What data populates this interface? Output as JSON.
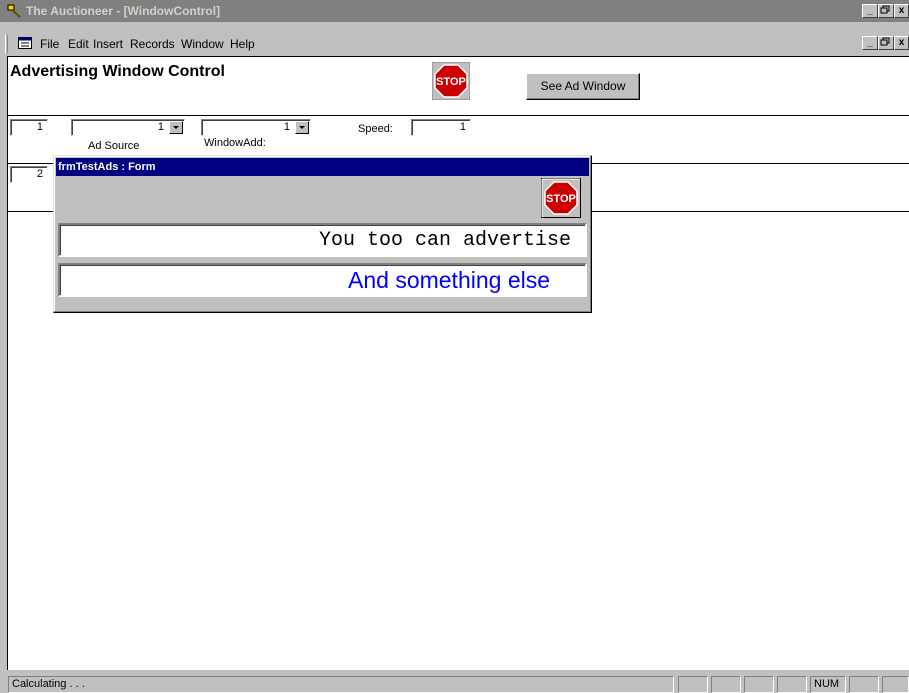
{
  "window": {
    "title": "The Auctioneer - [WindowControl]",
    "controls": [
      "_",
      " ",
      "x"
    ]
  },
  "menu": {
    "items": [
      "File",
      "Edit",
      "Insert",
      "Records",
      "Window",
      "Help"
    ]
  },
  "form": {
    "title": "Advertising Window Control",
    "stop_label": "STOP",
    "see_ad_button": "See Ad Window",
    "rows": [
      {
        "number": "1",
        "ad_source_value": "1",
        "ad_source_label": "Ad Source",
        "window_add_value": "1",
        "window_add_label": "WindowAdd:",
        "speed_label": "Speed:",
        "speed_value": "1"
      },
      {
        "number": "2"
      }
    ]
  },
  "popup": {
    "title": "frmTestAds : Form",
    "stop_label": "STOP",
    "ad_text_1": "You too can advertise",
    "ad_text_2": "And something else"
  },
  "status": {
    "text": "Calculating . . .",
    "num_indicator": "NUM"
  },
  "colors": {
    "title_active": "#000080",
    "title_inactive": "#808080",
    "stop_red": "#cc0000",
    "ad_blue": "#0000ff"
  }
}
